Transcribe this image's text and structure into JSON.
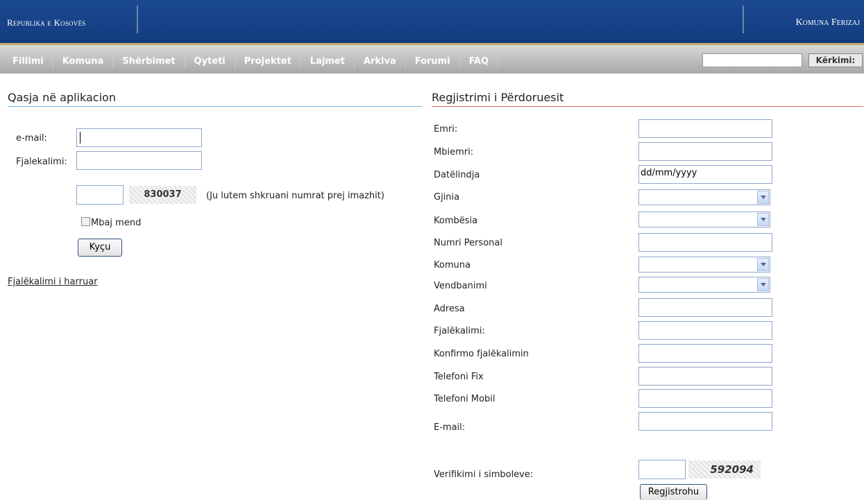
{
  "header": {
    "left_title": "Republika e Kosovës",
    "right_title": "Komuna Ferizaj"
  },
  "nav": {
    "items": [
      "Fillimi",
      "Komuna",
      "Shërbimet",
      "Qyteti",
      "Projektet",
      "Lajmet",
      "Arkiva",
      "Forumi",
      "FAQ"
    ],
    "search_value": "",
    "search_button": "Kërkimi:"
  },
  "login": {
    "heading": "Qasja në aplikacion",
    "email_label": "e-mail:",
    "password_label": "Fjalekalimi:",
    "captcha_code": "830037",
    "captcha_hint": "(Ju lutem shkruani numrat prej imazhit)",
    "remember_label": "Mbaj mend",
    "login_button": "Kyçu",
    "forgot_link": "Fjalëkalimi i harruar"
  },
  "register": {
    "heading": "Regjistrimi i Përdoruesit",
    "labels": {
      "name": "Emri:",
      "surname": "Mbiemri:",
      "birthdate": "Datëlindja",
      "gender": "Gjinia",
      "nationality": "Kombësia",
      "personal_number": "Numri Personal",
      "municipality": "Komuna",
      "residence": "Vendbanimi",
      "address": "Adresa",
      "password": "Fjalëkalimi:",
      "confirm_password": "Konfirmo fjalëkalimin",
      "phone_fix": "Telefoni Fix",
      "phone_mobile": "Telefoni Mobil",
      "email": "E-mail:",
      "verification": "Verifikimi i simboleve:"
    },
    "birthdate_value": "dd/mm/yyyy",
    "captcha_code": "592094",
    "register_button": "Regjistrohu"
  }
}
